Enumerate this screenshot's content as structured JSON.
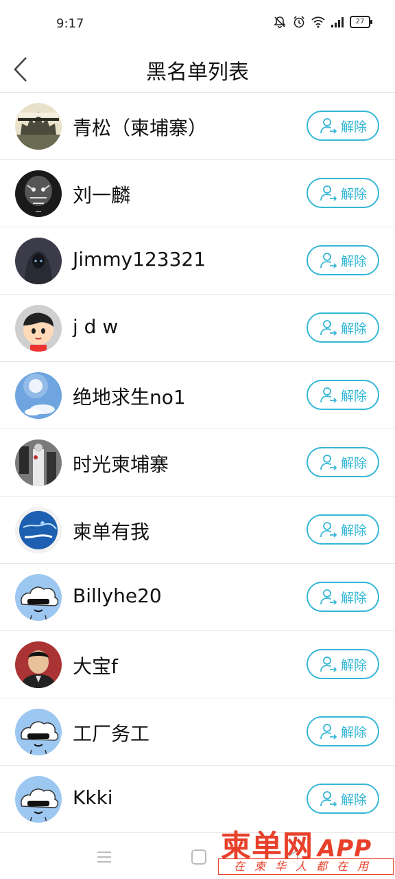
{
  "status_bar": {
    "time": "9:17",
    "battery": "27",
    "icons": [
      "mute-bell-icon",
      "alarm-icon",
      "wifi-icon",
      "signal-icon",
      "battery-icon"
    ]
  },
  "header": {
    "title": "黑名单列表",
    "back_icon": "back-chevron-icon"
  },
  "unblock_label": "解除",
  "unblock_icon": "user-exit-icon",
  "accent_color": "#34b7d6",
  "rows": [
    {
      "name": "青松（柬埔寨）"
    },
    {
      "name": "刘一麟"
    },
    {
      "name": "Jimmy123321"
    },
    {
      "name": "j d w"
    },
    {
      "name": "绝地求生no1"
    },
    {
      "name": "时光柬埔寨"
    },
    {
      "name": "柬单有我"
    },
    {
      "name": "Billyhe20"
    },
    {
      "name": "大宝f"
    },
    {
      "name": "工厂务工"
    },
    {
      "name": "Kkki"
    }
  ],
  "watermark": {
    "brand": "柬单网",
    "app": "APP",
    "slogan": "在柬华人都在用"
  },
  "nav_bar": [
    "menu-icon",
    "home-icon",
    "back-icon"
  ]
}
